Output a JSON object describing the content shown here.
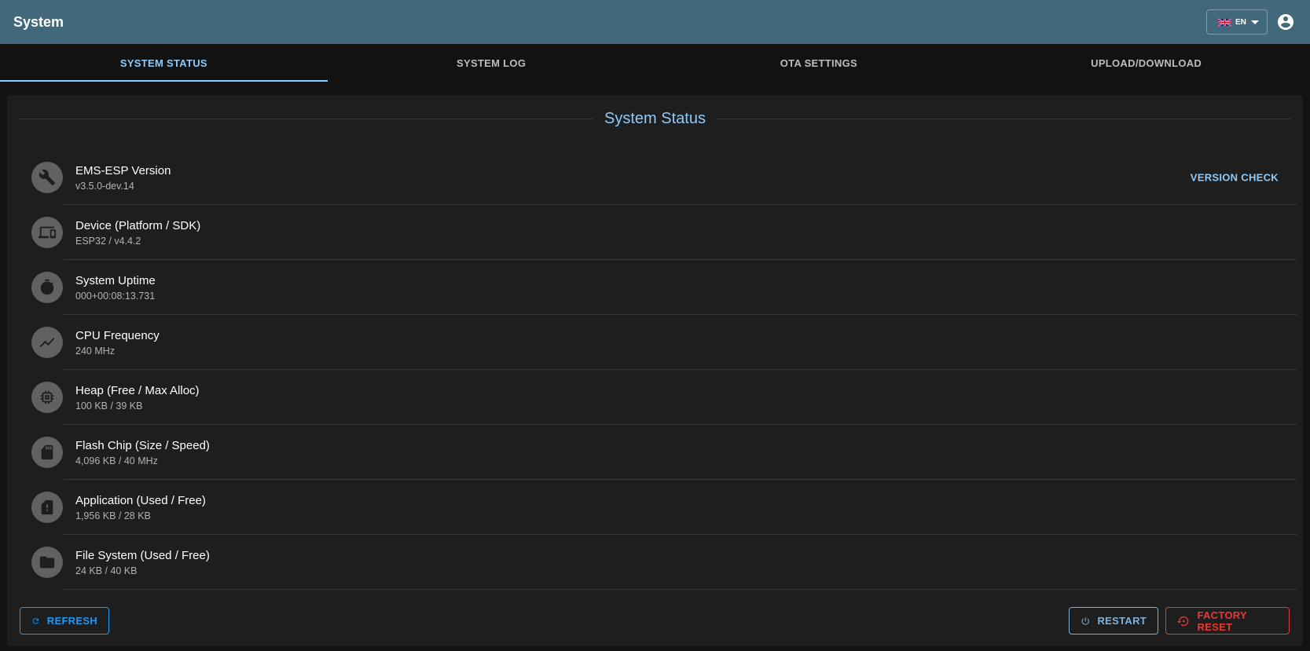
{
  "appbar": {
    "title": "System",
    "language": "EN"
  },
  "tabs": [
    {
      "label": "SYSTEM STATUS",
      "active": true
    },
    {
      "label": "SYSTEM LOG",
      "active": false
    },
    {
      "label": "OTA SETTINGS",
      "active": false
    },
    {
      "label": "UPLOAD/DOWNLOAD",
      "active": false
    }
  ],
  "panel": {
    "title": "System Status"
  },
  "status_items": [
    {
      "icon": "wrench-icon",
      "label": "EMS-ESP Version",
      "value": "v3.5.0-dev.14",
      "action": "VERSION CHECK"
    },
    {
      "icon": "devices-icon",
      "label": "Device (Platform / SDK)",
      "value": "ESP32 / v4.4.2"
    },
    {
      "icon": "timer-icon",
      "label": "System Uptime",
      "value": "000+00:08:13.731"
    },
    {
      "icon": "trend-icon",
      "label": "CPU Frequency",
      "value": "240 MHz"
    },
    {
      "icon": "memory-icon",
      "label": "Heap (Free / Max Alloc)",
      "value": "100 KB / 39 KB"
    },
    {
      "icon": "sd-card-icon",
      "label": "Flash Chip (Size / Speed)",
      "value": "4,096 KB / 40 MHz"
    },
    {
      "icon": "sd-card-alert-icon",
      "label": "Application (Used / Free)",
      "value": "1,956 KB / 28 KB"
    },
    {
      "icon": "folder-icon",
      "label": "File System (Used / Free)",
      "value": "24 KB / 40 KB"
    }
  ],
  "buttons": {
    "refresh": "REFRESH",
    "restart": "RESTART",
    "factory_reset": "FACTORY RESET"
  },
  "colors": {
    "appbar": "#41687b",
    "accent": "#90caf9",
    "primary_button": "#2196f3",
    "danger": "#e53935",
    "panel": "#1e1e1e",
    "background": "#121212"
  }
}
